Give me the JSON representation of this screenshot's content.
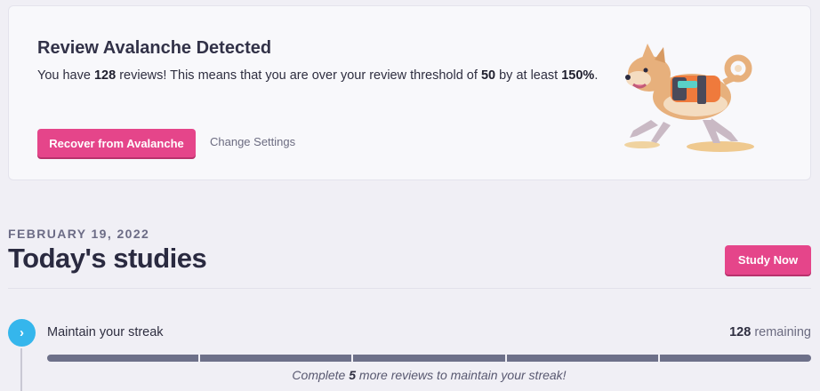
{
  "alert": {
    "title": "Review Avalanche Detected",
    "body_prefix": "You have ",
    "review_count": "128",
    "body_mid1": " reviews! This means that you are over your review threshold of ",
    "threshold": "50",
    "body_mid2": " by at least ",
    "percent": "150%",
    "body_suffix": ".",
    "recover_button": "Recover from Avalanche",
    "settings_link": "Change Settings",
    "illustration_icon": "shiba-dog-icon"
  },
  "studies": {
    "date": "FEBRUARY 19, 2022",
    "title": "Today's studies",
    "study_button": "Study Now"
  },
  "streak": {
    "step_icon": "chevron-right-icon",
    "step_glyph": "›",
    "label": "Maintain your streak",
    "remaining_count": "128",
    "remaining_label": " remaining",
    "progress_segments": 5,
    "hint_prefix": "Complete ",
    "hint_count": "5",
    "hint_suffix": " more reviews to maintain your streak!"
  },
  "colors": {
    "accent": "#e5458a",
    "step": "#35b6ec",
    "progress": "#6d7089",
    "background": "#f0eff5"
  }
}
